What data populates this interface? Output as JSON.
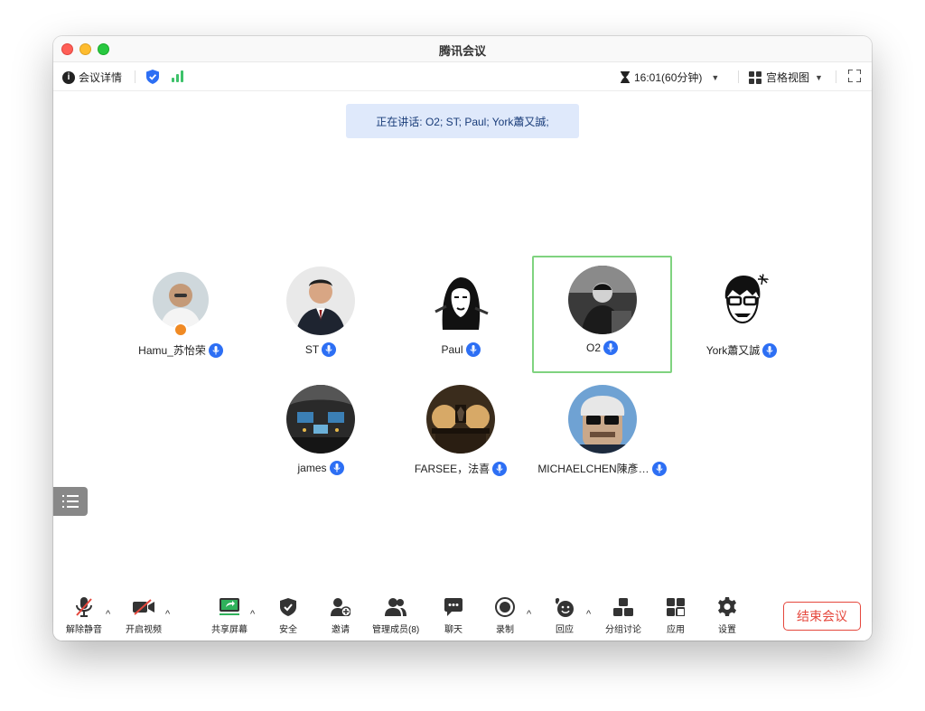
{
  "window": {
    "title": "腾讯会议"
  },
  "infobar": {
    "meeting_details": "会议详情",
    "timer": "16:01(60分钟)",
    "view_mode": "宫格视图"
  },
  "speaking": "正在讲话: O2; ST; Paul; York蕭又誠;",
  "participants": [
    {
      "name": "Hamu_苏怡荣"
    },
    {
      "name": "ST"
    },
    {
      "name": "Paul"
    },
    {
      "name": "O2"
    },
    {
      "name": "York蕭又誠"
    },
    {
      "name": "james"
    },
    {
      "name": "FARSEE，法喜"
    },
    {
      "name": "MICHAELCHEN陳彥…"
    }
  ],
  "toolbar": {
    "unmute": "解除静音",
    "start_video": "开启视频",
    "share_screen": "共享屏幕",
    "security": "安全",
    "invite": "邀请",
    "manage_members": "管理成员(8)",
    "chat": "聊天",
    "record": "录制",
    "reactions": "回应",
    "breakout": "分组讨论",
    "apps": "应用",
    "settings": "设置",
    "end_meeting": "结束会议"
  },
  "colors": {
    "accent": "#2d6ff4",
    "active_border": "#7fd37f",
    "end": "#e5473c",
    "speaking_bg": "#dfe9fb"
  }
}
